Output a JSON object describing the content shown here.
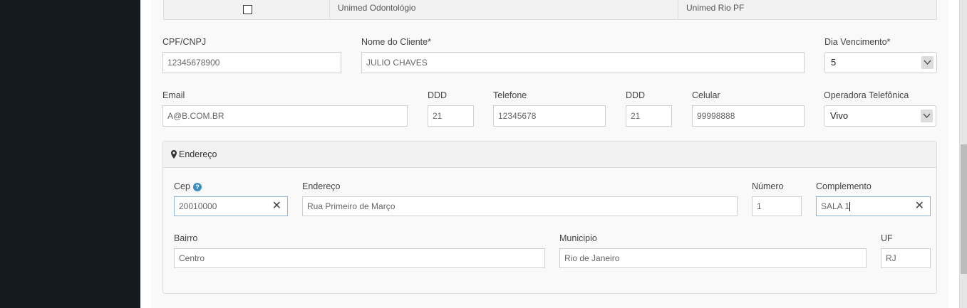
{
  "table_row": {
    "col_a": "Unimed Odontológio",
    "col_b": "Unimed Rio PF"
  },
  "form": {
    "cpf": {
      "label": "CPF/CNPJ",
      "value": "12345678900"
    },
    "nome": {
      "label": "Nome do Cliente*",
      "value": "JULIO CHAVES"
    },
    "dia_vencimento": {
      "label": "Dia Vencimento*",
      "value": "5"
    },
    "email": {
      "label": "Email",
      "value": "A@B.COM.BR"
    },
    "ddd1": {
      "label": "DDD",
      "value": "21"
    },
    "telefone": {
      "label": "Telefone",
      "value": "12345678"
    },
    "ddd2": {
      "label": "DDD",
      "value": "21"
    },
    "celular": {
      "label": "Celular",
      "value": "99998888"
    },
    "operadora": {
      "label": "Operadora Telefônica",
      "value": "Vivo"
    }
  },
  "endereco_panel": {
    "title": "Endereço",
    "cep": {
      "label": "Cep",
      "value": "20010000"
    },
    "endereco": {
      "label": "Endereço",
      "value": "Rua Primeiro de Março"
    },
    "numero": {
      "label": "Número",
      "value": "1"
    },
    "complemento": {
      "label": "Complemento",
      "value": "SALA 1"
    },
    "bairro": {
      "label": "Bairro",
      "value": "Centro"
    },
    "municipio": {
      "label": "Municipio",
      "value": "Rio de Janeiro"
    },
    "uf": {
      "label": "UF",
      "value": "RJ"
    }
  },
  "icons": {
    "pin": "map-marker-icon",
    "help": "question-circle-icon",
    "clear": "close-icon",
    "dropdown": "chevron-down-icon"
  },
  "colors": {
    "sidebar": "#151a1e",
    "focus_border": "#8fb4d6",
    "help_icon": "#3b8fc4"
  }
}
